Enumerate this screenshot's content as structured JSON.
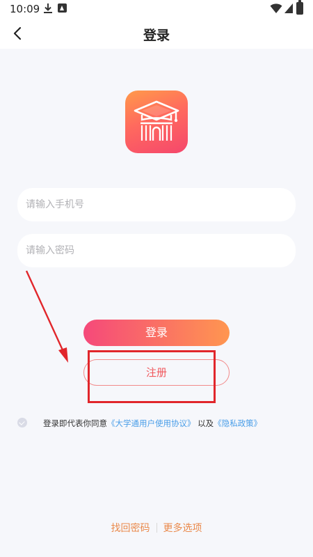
{
  "status_bar": {
    "time": "10:09"
  },
  "header": {
    "title": "登录"
  },
  "form": {
    "phone_placeholder": "请输入手机号",
    "password_placeholder": "请输入密码",
    "login_label": "登录",
    "register_label": "注册"
  },
  "agreement": {
    "prefix": "登录即代表你同意",
    "user_agreement": "《大学通用户使用协议》",
    "conjunction": "以及",
    "privacy_policy": "《隐私政策》"
  },
  "footer": {
    "forgot_password": "找回密码",
    "more_options": "更多选项"
  },
  "colors": {
    "gradient_start": "#f5497a",
    "gradient_end": "#ff9650",
    "link": "#4a9ee8",
    "footer_link": "#ea8a4c",
    "annotation_red": "#e1262b"
  },
  "icons": {
    "logo": "graduation-cap-building-icon",
    "back": "chevron-left-icon"
  }
}
